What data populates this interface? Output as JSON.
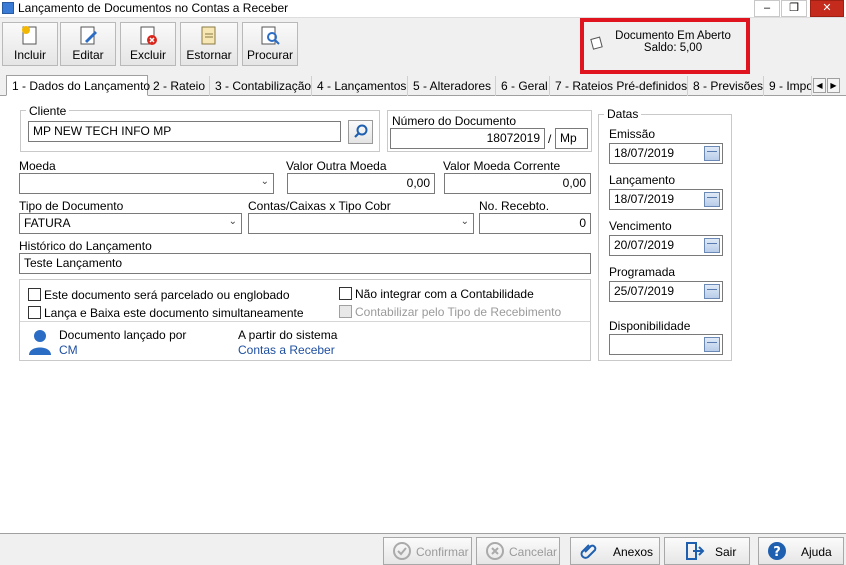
{
  "window": {
    "title": "Lançamento de Documentos no Contas a Receber"
  },
  "toolbar": {
    "incluir": "Incluir",
    "editar": "Editar",
    "excluir": "Excluir",
    "estornar": "Estornar",
    "procurar": "Procurar"
  },
  "status": {
    "line1": "Documento Em Aberto",
    "line2": "Saldo: 5,00"
  },
  "tabs": [
    "1 - Dados do Lançamento",
    "2 - Rateio",
    "3 - Contabilização",
    "4 - Lançamentos",
    "5 - Alteradores",
    "6 - Geral",
    "7 - Rateios Pré-definidos",
    "8 - Previsões",
    "9 - Impo"
  ],
  "form": {
    "cliente_label": "Cliente",
    "cliente_value": "MP NEW TECH INFO MP",
    "numero_label": "Número do Documento",
    "numero_value": "18072019",
    "numero_sep": "/",
    "numero_suffix": "Mp",
    "moeda_label": "Moeda",
    "moeda_value": "",
    "valor_outra_label": "Valor Outra Moeda",
    "valor_outra_value": "0,00",
    "valor_corrente_label": "Valor Moeda Corrente",
    "valor_corrente_value": "0,00",
    "tipo_doc_label": "Tipo de Documento",
    "tipo_doc_value": "FATURA",
    "contas_label": "Contas/Caixas x Tipo Cobr",
    "contas_value": "",
    "recebto_label": "No. Recebto.",
    "recebto_value": "0",
    "historico_label": "Histórico do Lançamento",
    "historico_value": "Teste Lançamento",
    "chk_parcelado": "Este documento será parcelado ou englobado",
    "chk_lanca_baixa": "Lança e Baixa este documento simultaneamente",
    "chk_nao_integrar": "Não integrar com a Contabilidade",
    "chk_contabilizar": "Contabilizar pelo Tipo de Recebimento",
    "lancado_por_label": "Documento lançado por",
    "lancado_por_value": "CM",
    "sistema_label": "A partir do sistema",
    "sistema_value": "Contas a Receber"
  },
  "datas": {
    "title": "Datas",
    "emissao_label": "Emissão",
    "emissao_value": "18/07/2019",
    "lancamento_label": "Lançamento",
    "lancamento_value": "18/07/2019",
    "vencimento_label": "Vencimento",
    "vencimento_value": "20/07/2019",
    "programada_label": "Programada",
    "programada_value": "25/07/2019",
    "disponibilidade_label": "Disponibilidade",
    "disponibilidade_value": ""
  },
  "bottom": {
    "confirmar": "Confirmar",
    "cancelar": "Cancelar",
    "anexos": "Anexos",
    "sair": "Sair",
    "ajuda": "Ajuda"
  }
}
